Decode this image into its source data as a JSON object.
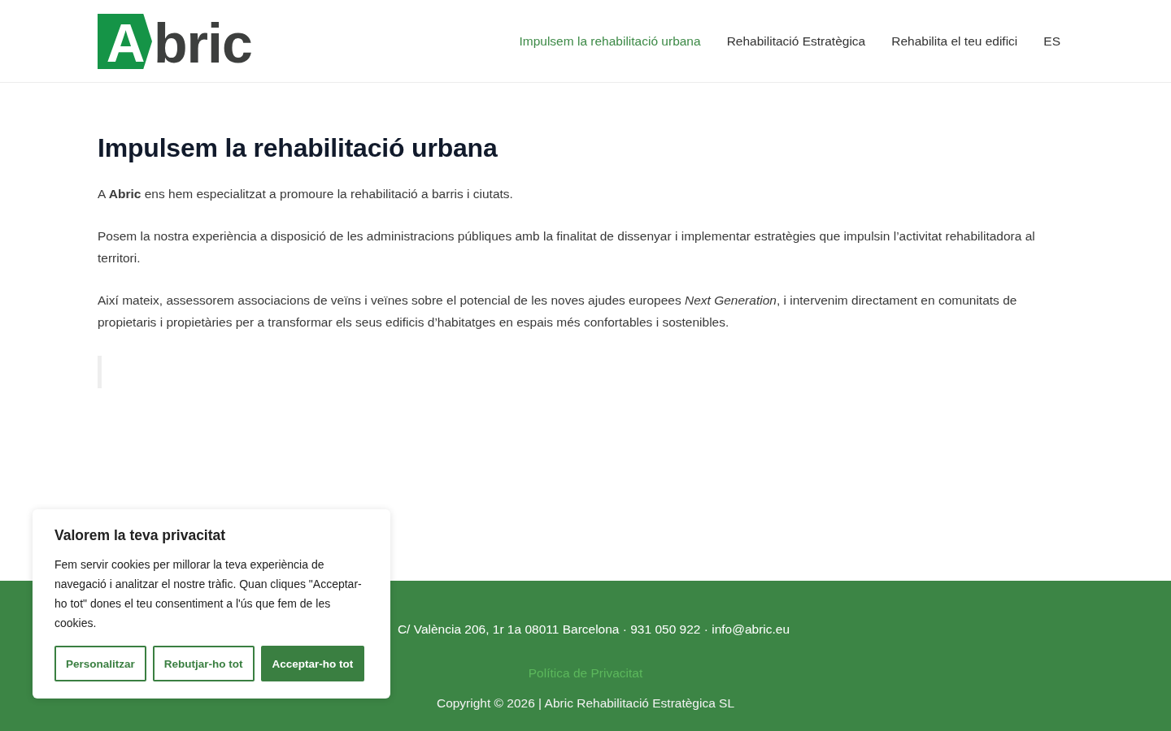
{
  "header": {
    "logo": {
      "mark": "A",
      "text": "bric"
    },
    "nav": [
      {
        "label": "Impulsem la rehabilitació urbana",
        "selected": true
      },
      {
        "label": "Rehabilitació Estratègica",
        "selected": false
      },
      {
        "label": "Rehabilita el teu edifici",
        "selected": false
      },
      {
        "label": "ES",
        "selected": false
      }
    ]
  },
  "main": {
    "title": "Impulsem la rehabilitació urbana",
    "paragraphs": [
      "A **Abric** ens hem especialitzat a promoure la rehabilitació a barris i ciutats.",
      "Posem la nostra experiència a disposició de les administracions públiques amb la finalitat de dissenyar i implementar estratègies que impulsin l’activitat rehabilitadora al territori.",
      "Així mateix, assessorem associacions de veïns i veïnes sobre el potencial de les noves ajudes europees *Next Generation*, i intervenim directament en comunitats de propietaris i propietàries per a transformar els seus edificis d’habitatges en espais més confortables i sostenibles."
    ]
  },
  "footer": {
    "address": "C/ València 206, 1r 1a 08011 Barcelona · 931 050 922 · info@abric.eu",
    "link": "Política de Privacitat",
    "copyright": "Copyright © 2026 | Abric Rehabilitació Estratègica SL"
  },
  "cookie_banner": {
    "title": "Valorem la teva privacitat",
    "text": "Fem servir cookies per millorar la teva experiència de navegació i analitzar el nostre tràfic. Quan cliques \"Acceptar-ho tot\" dones el teu consentiment a l'ús que fem de les cookies.",
    "buttons": [
      {
        "label": "Personalitzar",
        "kind": "outline"
      },
      {
        "label": "Rebutjar-ho tot",
        "kind": "outline"
      },
      {
        "label": "Acceptar-ho tot",
        "kind": "filled"
      }
    ]
  }
}
